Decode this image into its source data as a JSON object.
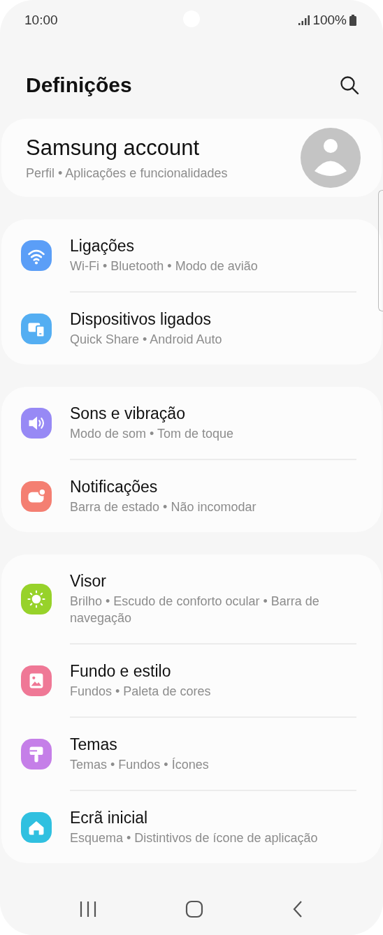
{
  "status_bar": {
    "time": "10:00",
    "battery": "100%"
  },
  "header": {
    "title": "Definições"
  },
  "account": {
    "title": "Samsung account",
    "subtitle": "Perfil • Aplicações e funcionalidades"
  },
  "groups": [
    {
      "items": [
        {
          "kind": "wifi",
          "color": "#5b9ef7",
          "title": "Ligações",
          "subtitle": "Wi-Fi • Bluetooth • Modo de avião"
        },
        {
          "kind": "devices",
          "color": "#54aef2",
          "title": "Dispositivos ligados",
          "subtitle": "Quick Share • Android Auto"
        }
      ]
    },
    {
      "items": [
        {
          "kind": "sound",
          "color": "#9789f5",
          "title": "Sons e vibração",
          "subtitle": "Modo de som • Tom de toque"
        },
        {
          "kind": "notification",
          "color": "#f47f72",
          "title": "Notificações",
          "subtitle": "Barra de estado • Não incomodar"
        }
      ]
    },
    {
      "items": [
        {
          "kind": "sun",
          "color": "#97d22a",
          "title": "Visor",
          "subtitle": "Brilho • Escudo de conforto ocular • Barra de navegação"
        },
        {
          "kind": "picture",
          "color": "#ef7896",
          "title": "Fundo e estilo",
          "subtitle": "Fundos • Paleta de cores"
        },
        {
          "kind": "brush",
          "color": "#c57fe8",
          "title": "Temas",
          "subtitle": "Temas • Fundos • Ícones"
        },
        {
          "kind": "home",
          "color": "#30c0e0",
          "title": "Ecrã inicial",
          "subtitle": "Esquema • Distintivos de ícone de aplicação"
        }
      ]
    }
  ]
}
